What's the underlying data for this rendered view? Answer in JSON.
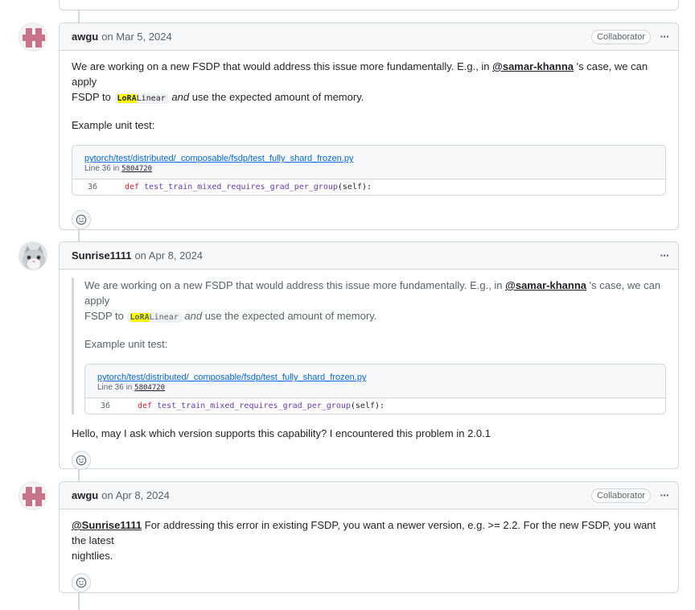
{
  "comments": [
    {
      "author": "awgu",
      "date": "on Mar 5, 2024",
      "badge": "Collaborator",
      "body_p1_a": "We are working on a new FSDP that would address this issue more fundamentally. E.g., in",
      "mention": "@samar-khanna",
      "body_p1_b": "'s case, we can apply",
      "body_p1_c": "FSDP to",
      "code_hl": "LoRA",
      "code_rest": "Linear",
      "body_p1_and": "and",
      "body_p1_d": "use the expected amount of memory.",
      "body_p2": "Example unit test:",
      "snippet": {
        "path": "pytorch/test/distributed/_composable/fsdp/test_fully_shard_frozen.py",
        "line_info_prefix": "Line 36 in",
        "sha": "5804720",
        "line_number": "36",
        "keyword": "def",
        "func": "test_train_mixed_requires_grad_per_group",
        "args": "(self):"
      }
    },
    {
      "author": "Sunrise1111",
      "date": "on Apr 8, 2024",
      "quote_p1_a": "We are working on a new FSDP that would address this issue more fundamentally. E.g., in",
      "mention": "@samar-khanna",
      "quote_p1_b": "'s case, we can apply",
      "quote_p1_c": "FSDP to",
      "code_hl": "LoRA",
      "code_rest": "Linear",
      "quote_p1_and": "and",
      "quote_p1_d": "use the expected amount of memory.",
      "quote_p2": "Example unit test:",
      "snippet": {
        "path": "pytorch/test/distributed/_composable/fsdp/test_fully_shard_frozen.py",
        "line_info_prefix": "Line 36 in",
        "sha": "5804720",
        "line_number": "36",
        "keyword": "def",
        "func": "test_train_mixed_requires_grad_per_group",
        "args": "(self):"
      },
      "body": "Hello, may I ask which version supports this capability? I encountered this problem in 2.0.1"
    },
    {
      "author": "awgu",
      "date": "on Apr 8, 2024",
      "badge": "Collaborator",
      "mention": "@Sunrise1111",
      "body_a": "For addressing this error in existing FSDP, you want a newer version, e.g. >= 2.2. For the new FSDP, you want the latest",
      "body_b": "nightlies."
    }
  ],
  "icons": {
    "kebab": "kebab-horizontal-icon",
    "reaction": "smiley-icon"
  },
  "kebab_glyph": "···",
  "colors": {
    "border": "#d0d7de",
    "header_bg": "#f6f8fa",
    "link": "#0969da",
    "highlight": "#ffff00",
    "keyword": "#cf222e",
    "function": "#6639ba",
    "identicon": "#c7738b"
  }
}
